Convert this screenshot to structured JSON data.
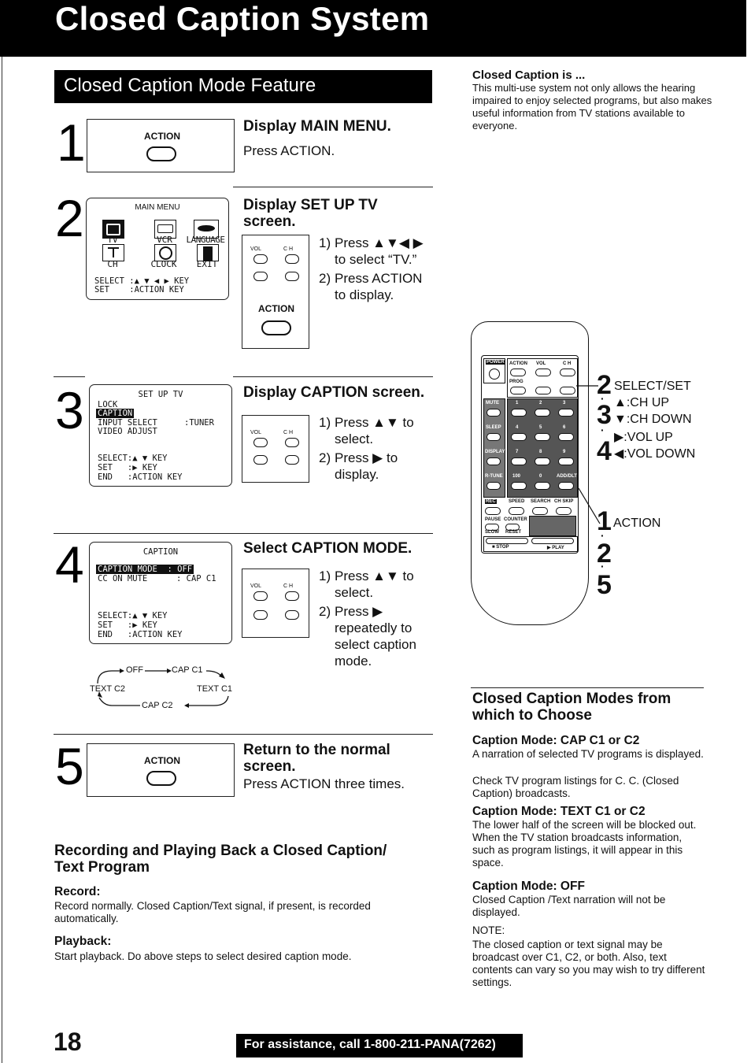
{
  "page": {
    "title": "Closed Caption System",
    "section_title": "Closed Caption Mode Feature",
    "page_number": "18",
    "footer": "For assistance, call 1-800-211-PANA(7262)"
  },
  "steps": [
    {
      "number": "1",
      "heading": "Display MAIN MENU.",
      "text": "Press ACTION.",
      "panel_label": "ACTION"
    },
    {
      "number": "2",
      "heading_line1": "Display SET UP TV",
      "heading_line2": "screen.",
      "instructions": [
        {
          "n": "1)",
          "text": "Press ▲▼◀ ▶ to select “TV.”"
        },
        {
          "n": "2)",
          "text": "Press ACTION to display."
        }
      ],
      "osd": {
        "title": "MAIN MENU",
        "icons": [
          {
            "label": "TV",
            "icon": "tv-icon",
            "selected": true
          },
          {
            "label": "VCR",
            "icon": "vcr-icon",
            "selected": false
          },
          {
            "label": "LANGUAGE",
            "icon": "lips-icon",
            "selected": false
          },
          {
            "label": "CH",
            "icon": "antenna-icon",
            "selected": false
          },
          {
            "label": "CLOCK",
            "icon": "clock-icon",
            "selected": false
          },
          {
            "label": "EXIT",
            "icon": "exit-door-icon",
            "selected": false
          }
        ],
        "footer_lines": [
          "SELECT :▲ ▼ ◀ ▶ KEY",
          "SET    :ACTION KEY"
        ]
      },
      "remote_labels": {
        "vol": "VOL",
        "ch": "C H",
        "action": "ACTION"
      }
    },
    {
      "number": "3",
      "heading": "Display CAPTION screen.",
      "instructions": [
        {
          "n": "1)",
          "text": "Press ▲▼ to select."
        },
        {
          "n": "2)",
          "text": "Press ▶ to display."
        }
      ],
      "osd": {
        "title": "SET UP TV",
        "items": [
          {
            "label": "LOCK",
            "value": "",
            "selected": false
          },
          {
            "label": "CAPTION",
            "value": "",
            "selected": true
          },
          {
            "label": "INPUT SELECT",
            "value": ":TUNER",
            "selected": false
          },
          {
            "label": "VIDEO ADJUST",
            "value": "",
            "selected": false
          }
        ],
        "footer_lines": [
          "SELECT:▲ ▼ KEY",
          "SET   :▶ KEY",
          "END   :ACTION KEY"
        ]
      },
      "remote_labels": {
        "vol": "VOL",
        "ch": "C H"
      }
    },
    {
      "number": "4",
      "heading": "Select CAPTION MODE.",
      "instructions": [
        {
          "n": "1)",
          "text": "Press ▲▼ to select."
        },
        {
          "n": "2)",
          "text": "Press ▶ repeatedly to select caption mode."
        }
      ],
      "osd": {
        "title": "CAPTION",
        "items": [
          {
            "label": "CAPTION MODE",
            "value": ": OFF",
            "selected": true
          },
          {
            "label": "CC ON MUTE",
            "value": ": CAP C1",
            "selected": false
          }
        ],
        "footer_lines": [
          "SELECT:▲ ▼ KEY",
          "SET   :▶ KEY",
          "END   :ACTION KEY"
        ]
      },
      "cycle": [
        "OFF",
        "CAP C1",
        "TEXT C1",
        "CAP C2",
        "TEXT C2"
      ],
      "remote_labels": {
        "vol": "VOL",
        "ch": "C H"
      }
    },
    {
      "number": "5",
      "heading_line1": "Return to the normal",
      "heading_line2": "screen.",
      "text": "Press ACTION three times.",
      "panel_label": "ACTION"
    }
  ],
  "recording": {
    "heading_line1": "Recording and Playing Back a Closed Caption/",
    "heading_line2": "Text Program",
    "record_heading": "Record:",
    "record_text": "Record normally. Closed Caption/Text signal, if present, is recorded automatically.",
    "playback_heading": "Playback:",
    "playback_text": "Start playback. Do above steps to select desired caption mode."
  },
  "intro": {
    "heading": "Closed Caption is ...",
    "text": "This multi-use system not only allows the hearing impaired to enjoy selected programs, but also makes useful information from TV stations available to everyone."
  },
  "remote": {
    "callouts": {
      "select_set": {
        "num": "2",
        "label": "SELECT/SET"
      },
      "ch_up": {
        "num": "3",
        "label": "▲:CH UP"
      },
      "ch_down": {
        "label": "▼:CH DOWN"
      },
      "vol_up": {
        "label": "▶:VOL UP"
      },
      "vol_down": {
        "num": "4",
        "label": "◀:VOL DOWN"
      },
      "action": {
        "num": "1",
        "label": "ACTION"
      },
      "action_step2": "2",
      "action_step5": "5"
    },
    "buttons": {
      "power": "POWER",
      "action": "ACTION",
      "vol": "VOL",
      "ch": "C H",
      "prog": "PROG",
      "mute": "MUTE",
      "sleep": "SLEEP",
      "display": "DISPLAY",
      "rtune": "R-TUNE",
      "keys": [
        "1",
        "2",
        "3",
        "4",
        "5",
        "6",
        "7",
        "8",
        "9",
        "100",
        "0",
        "ADD/DLT"
      ],
      "rec": "REC",
      "speed": "SPEED",
      "search": "SEARCH",
      "chskip": "CH SKIP",
      "pause": "PAUSE",
      "counter": "COUNTER",
      "slow": "SLOW",
      "reset": "RESET",
      "stop": "■ STOP",
      "play": "▶ PLAY"
    }
  },
  "modes": {
    "heading_line1": "Closed Caption Modes from",
    "heading_line2": "which to Choose",
    "items": [
      {
        "heading": "Caption Mode: CAP C1 or C2",
        "text": "A narration of selected TV programs is displayed.",
        "text2": "Check TV program listings for C. C. (Closed Caption) broadcasts."
      },
      {
        "heading": "Caption Mode: TEXT C1 or C2",
        "text": "The lower half of the screen will be blocked out. When the TV station broadcasts information, such as program listings, it will appear in this space."
      },
      {
        "heading": "Caption Mode: OFF",
        "text": "Closed Caption /Text narration will not be displayed."
      }
    ],
    "note_label": "NOTE:",
    "note_text": "The closed caption or text signal may be broadcast over C1, C2, or both. Also, text contents can vary so you may wish to try different settings."
  }
}
